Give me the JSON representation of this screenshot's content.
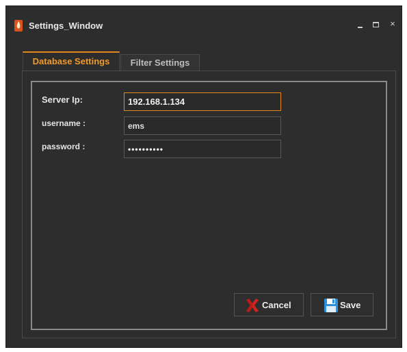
{
  "window": {
    "title": "Settings_Window",
    "icon": "app-flame-icon",
    "controls": {
      "minimize": "minimize-icon",
      "maximize": "maximize-icon",
      "close": "×"
    }
  },
  "tabs": [
    {
      "label": "Database Settings",
      "active": true
    },
    {
      "label": "Filter Settings",
      "active": false
    }
  ],
  "form": {
    "server_ip": {
      "label": "Server Ip:",
      "value": "192.168.1.134"
    },
    "username": {
      "label": "username :",
      "value": "ems"
    },
    "password": {
      "label": "password :",
      "value": "••••••••••"
    }
  },
  "buttons": {
    "cancel": {
      "label": "Cancel",
      "icon": "red-x-icon"
    },
    "save": {
      "label": "Save",
      "icon": "floppy-disk-icon"
    }
  },
  "colors": {
    "background": "#2d2d2d",
    "accent": "#e38a1f",
    "text": "#e4e4e4"
  }
}
